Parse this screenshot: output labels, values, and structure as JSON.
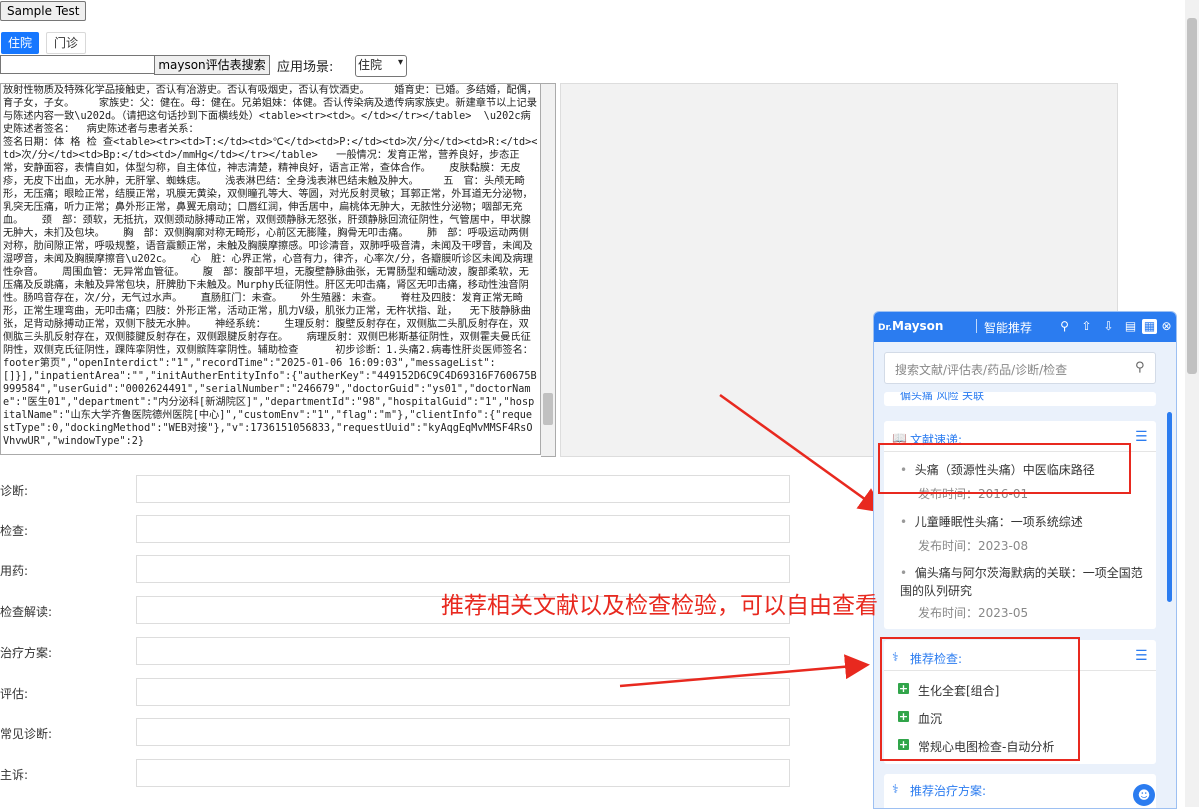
{
  "toolbar": {
    "sample_test_label": "Sample Test",
    "tabs": [
      {
        "label": "住院"
      },
      {
        "label": "门诊"
      }
    ],
    "search_button_label": "mayson评估表搜索",
    "scene_label": "应用场景:",
    "scene_value": "住院"
  },
  "record_text": "放射性物质及特殊化学品接触史，否认有冶游史。否认有吸烟史，否认有饮酒史。    婚育史：已婚。多结婚，配偶，育子女，子女。    家族史：父：健在。母：健在。兄弟姐妹：体健。否认传染病及遗传病家族史。新建章节以上记录与陈述内容一致\\u202d。（请把这句话抄到下面横线处）<table><tr><td>。</td></tr></table>  \\u202c病史陈述者签名：  病史陈述者与患者关系：\n签名日期：体 格 检 查<table><tr><td>T:</td><td>℃</td><td>P:</td><td>次/分</td><td>R:</td><td>次/分</td><td>Bp:</td><td>/mmHg</td></tr></table>   一般情况：发育正常，营养良好，步态正常，安静面容，表情自如，体型匀称，自主体位，神志清楚，精神良好，语言正常，查体合作。   皮肤黏膜：无皮疹，无皮下出血，无水肿，无肝掌、蜘蛛痣。   浅表淋巴结：全身浅表淋巴结未触及肿大。    五　官：头颅无畸形，无压痛；眼睑正常，结膜正常，巩膜无黄染，双侧瞳孔等大、等圆，对光反射灵敏；耳郭正常，外耳道无分泌物，乳突无压痛，听力正常；鼻外形正常，鼻翼无扇动；口唇红润，伸舌居中，扁桃体无肿大，无脓性分泌物；咽部无充血。   颈　部：颈软，无抵抗，双侧颈动脉搏动正常，双侧颈静脉无怒张，肝颈静脉回流征阴性，气管居中，甲状腺无肿大，未扪及包块。   胸　部：双侧胸廓对称无畸形，心前区无膨隆，胸骨无叩击痛。   肺　部：呼吸运动两侧对称，肋间隙正常，呼吸规整，语音震颤正常，未触及胸膜摩擦感。叩诊清音，双肺呼吸音清，未闻及干啰音，未闻及湿啰音，未闻及胸膜摩擦音\\u202c。   心　脏：心界正常，心音有力，律齐，心率次/分，各瓣膜听诊区未闻及病理性杂音。   周围血管：无异常血管征。   腹　部：腹部平坦，无腹壁静脉曲张，无胃肠型和蠕动波，腹部柔软，无压痛及反跳痛，未触及异常包块，肝脾肋下未触及。Murphy氏征阴性。肝区无叩击痛，肾区无叩击痛，移动性浊音阴性。肠鸣音存在，次/分，无气过水声。   直肠肛门：未查。   外生殖器：未查。   脊柱及四肢：发育正常无畸形，正常生理弯曲，无叩击痛；四肢：外形正常，活动正常，肌力V级，肌张力正常，无杵状指、趾，  无下肢静脉曲张，足背动脉搏动正常，双侧下肢无水肿。   神经系统：   生理反射：腹壁反射存在，双侧肱二头肌反射存在，双侧肱三头肌反射存在，双侧膝腱反射存在，双侧跟腱反射存在。   病理反射：双侧巴彬斯基征阴性，双侧霍夫曼氏征阴性，双侧克氏征阴性，踝阵挛阴性，双侧髌阵挛阴性。辅助检查      初步诊断：1.头痛2.病毒性肝炎医师签名：footer第页\",\"openInterdict\":\"1\",\"recordTime\":\"2025-01-06 16:09:03\",\"messageList\":[]}],\"inpatientArea\":\"\",\"initAutherEntityInfo\":{\"autherKey\":\"449152D6C9C4D69316F760675B999584\",\"userGuid\":\"0002624491\",\"serialNumber\":\"246679\",\"doctorGuid\":\"ys01\",\"doctorName\":\"医生01\",\"department\":\"内分泌科[新湖院区]\",\"departmentId\":\"98\",\"hospitalGuid\":\"1\",\"hospitalName\":\"山东大学齐鲁医院德州医院[中心]\",\"customEnv\":\"1\",\"flag\":\"m\"},\"clientInfo\":{\"requestType\":0,\"dockingMethod\":\"WEB对接\"},\"v\":1736151056833,\"requestUuid\":\"kyAqgEqMvMMSF4RsOVhvwUR\",\"windowType\":2}",
  "form": {
    "fields": [
      {
        "label": "诊断:"
      },
      {
        "label": "检查:"
      },
      {
        "label": "用药:"
      },
      {
        "label": "检查解读:"
      },
      {
        "label": "治疗方案:"
      },
      {
        "label": "评估:"
      },
      {
        "label": "常见诊断:"
      },
      {
        "label": "主诉:"
      }
    ]
  },
  "panel": {
    "brand": "Mayson",
    "title": "智能推荐",
    "search_placeholder": "搜索文献/评估表/药品/诊断/检查",
    "cut_text": "偏头痛 风险 关联",
    "literature": {
      "title": "文献速递:",
      "items": [
        {
          "title": "头痛（颈源性头痛）中医临床路径",
          "date": "发布时间：2016-01"
        },
        {
          "title": "儿童睡眠性头痛：一项系统综述",
          "date": "发布时间：2023-08"
        },
        {
          "title": "偏头痛与阿尔茨海默病的关联：一项全国范围的队列研究",
          "date": "发布时间：2023-05"
        }
      ]
    },
    "exams": {
      "title": "推荐检查:",
      "items": [
        {
          "label": "生化全套[组合]"
        },
        {
          "label": "血沉"
        },
        {
          "label": "常规心电图检查-自动分析"
        }
      ]
    },
    "treatment": {
      "title": "推荐治疗方案:"
    }
  },
  "annotation": {
    "text": "推荐相关文献以及检查检验，可以自由查看",
    "color": "#e8291f"
  }
}
